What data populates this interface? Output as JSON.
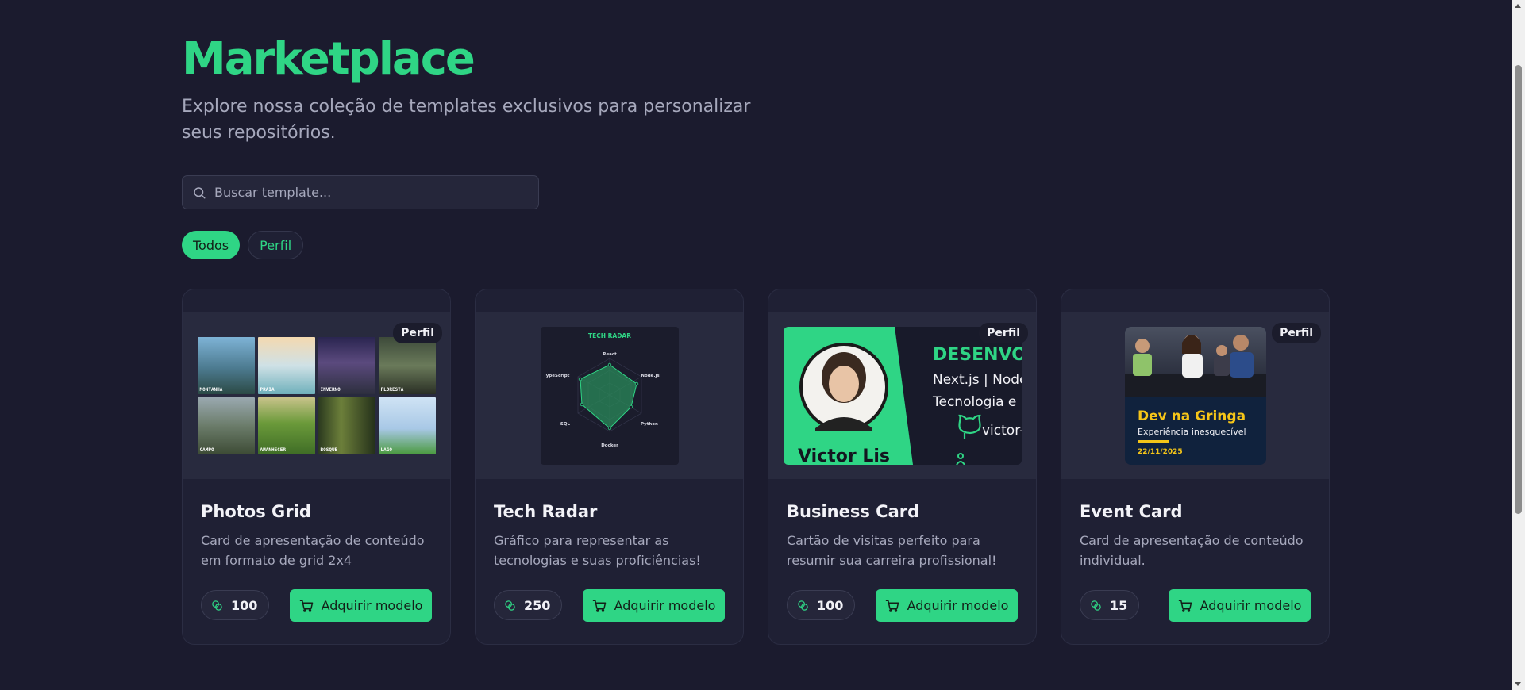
{
  "header": {
    "title": "Marketplace",
    "subtitle": "Explore nossa coleção de templates exclusivos para personalizar seus repositórios."
  },
  "search": {
    "placeholder": "Buscar template...",
    "icon": "search-icon"
  },
  "filters": [
    {
      "label": "Todos",
      "active": true
    },
    {
      "label": "Perfil",
      "active": false
    }
  ],
  "colors": {
    "accent": "#2fd585",
    "background": "#1b1b2e",
    "card": "#1f2034"
  },
  "cards": [
    {
      "badge": "Perfil",
      "title": "Photos Grid",
      "description": "Card de apresentação de conteúdo em formato de grid 2x4",
      "price": "100",
      "button_label": "Adquirir modelo",
      "photo_labels": [
        "MONTANHA",
        "PRAIA",
        "INVERNO",
        "FLORESTA",
        "CAMPO",
        "AMANHECER",
        "BOSQUE",
        "LAGO"
      ]
    },
    {
      "badge": "",
      "title": "Tech Radar",
      "description": "Gráfico para representar as tecnologias e suas proficiências!",
      "price": "250",
      "button_label": "Adquirir modelo",
      "radar_title": "TECH RADAR",
      "radar_axes": [
        "React",
        "Node.js",
        "Python",
        "Docker",
        "SQL",
        "TypeScript"
      ]
    },
    {
      "badge": "Perfil",
      "title": "Business Card",
      "description": "Cartão de visitas perfeito para resumir sua carreira profissional!",
      "price": "100",
      "button_label": "Adquirir modelo",
      "bc_heading": "DESENVOL",
      "bc_line1": "Next.js | Node",
      "bc_line2": "Tecnologia e I",
      "bc_github": "victor-l",
      "bc_name": "Victor Lis"
    },
    {
      "badge": "Perfil",
      "title": "Event Card",
      "description": "Card de apresentação de conteúdo individual.",
      "price": "15",
      "button_label": "Adquirir modelo",
      "ev_title": "Dev na Gringa",
      "ev_subtitle": "Experiência inesquecível",
      "ev_date": "22/11/2025"
    }
  ]
}
